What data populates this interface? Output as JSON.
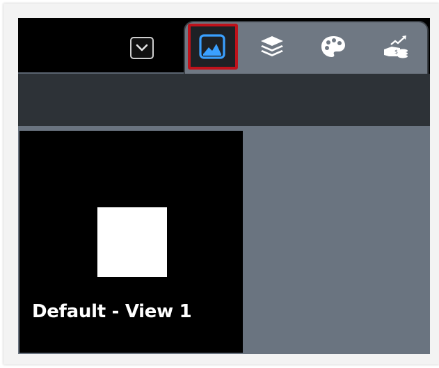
{
  "colors": {
    "topbar_bg": "#000000",
    "toolbar_bg": "#2d3237",
    "panel_bg": "#6a7480",
    "tab_strip_bg": "#6f7883",
    "active_tab_highlight": "#c0121b",
    "active_icon": "#3aa0ff",
    "icon": "#ffffff"
  },
  "dropdown": {
    "icon": "chevron-down-icon"
  },
  "tabs": [
    {
      "icon": "image-icon",
      "active": true
    },
    {
      "icon": "layers-icon",
      "active": false
    },
    {
      "icon": "palette-icon",
      "active": false
    },
    {
      "icon": "chart-money-icon",
      "active": false
    }
  ],
  "viewport": {
    "label": "Default - View 1"
  }
}
